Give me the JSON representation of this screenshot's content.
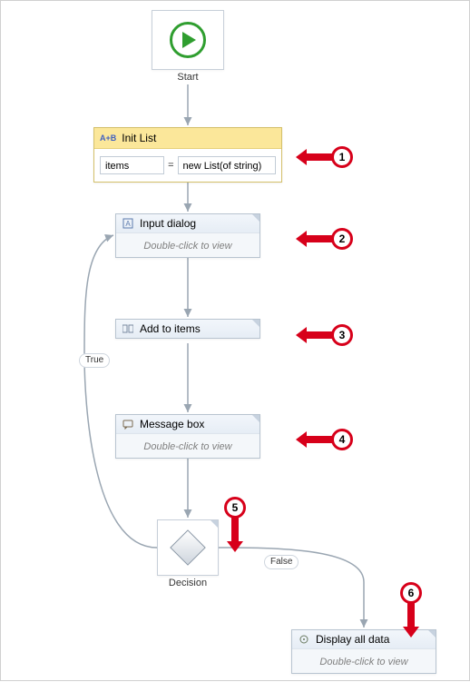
{
  "start": {
    "label": "Start"
  },
  "init": {
    "icon_label": "A+B",
    "title": "Init List",
    "var_name": "items",
    "equals": "=",
    "expression": "new List(of string)"
  },
  "input_dialog": {
    "title": "Input dialog",
    "hint": "Double-click to view"
  },
  "add_items": {
    "title": "Add to items"
  },
  "message_box": {
    "title": "Message box",
    "hint": "Double-click to view"
  },
  "decision": {
    "label": "Decision",
    "true_label": "True",
    "false_label": "False"
  },
  "display_all": {
    "title": "Display all data",
    "hint": "Double-click to view"
  },
  "callouts": {
    "c1": "1",
    "c2": "2",
    "c3": "3",
    "c4": "4",
    "c5": "5",
    "c6": "6"
  }
}
